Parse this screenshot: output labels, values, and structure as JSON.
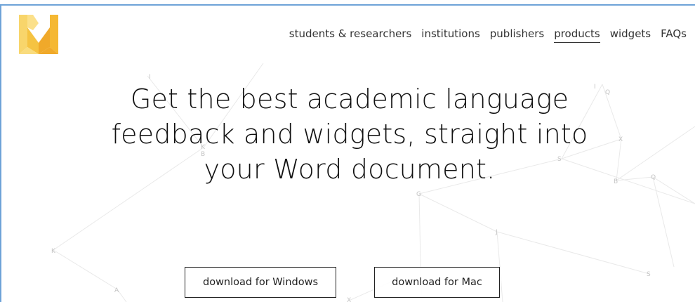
{
  "brand": {
    "logo_icon": "writefull-w-logo-icon",
    "colors": {
      "logo_light": "#f8d56b",
      "logo_mid": "#f5c342",
      "logo_dark": "#f0a92a",
      "frame": "#6ea3d8"
    }
  },
  "nav": {
    "items": [
      {
        "label": "students & researchers",
        "active": false
      },
      {
        "label": "institutions",
        "active": false
      },
      {
        "label": "publishers",
        "active": false
      },
      {
        "label": "products",
        "active": true
      },
      {
        "label": "widgets",
        "active": false
      },
      {
        "label": "FAQs",
        "active": false
      }
    ]
  },
  "hero": {
    "headline_line1": "Get the best academic language",
    "headline_line2": "feedback and widgets, straight into",
    "headline_line3": "your Word document."
  },
  "downloads": {
    "windows_label": "download for Windows",
    "mac_label": "download for Mac"
  },
  "background_letters": [
    "I",
    "Q",
    "K",
    "B",
    "X",
    "S",
    "B",
    "Q",
    "G",
    "J",
    "K",
    "A",
    "S",
    "X",
    "I"
  ]
}
